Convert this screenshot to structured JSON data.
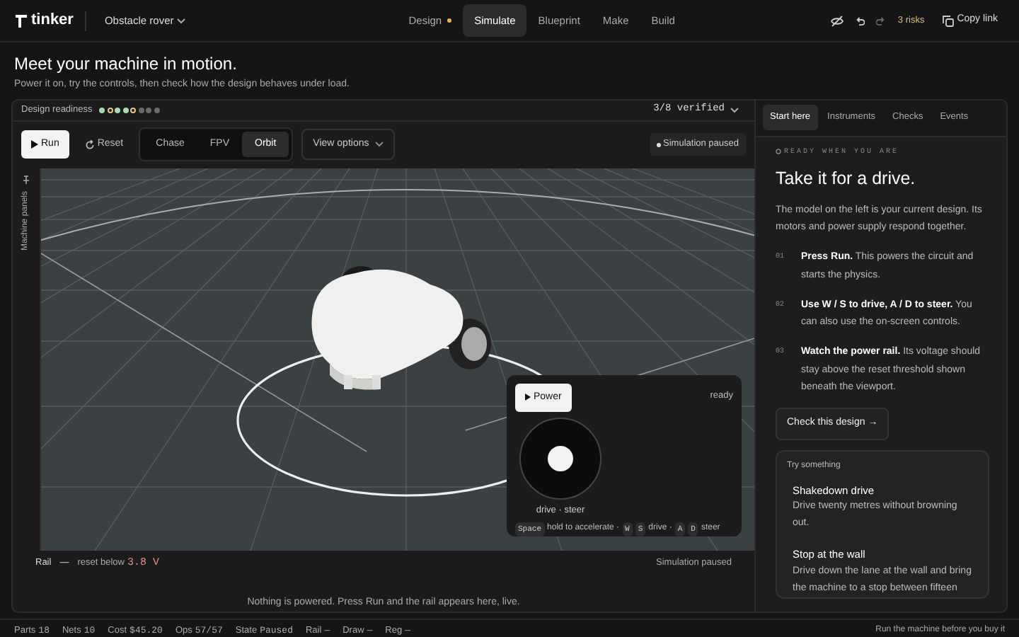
{
  "app": {
    "name": "tinker",
    "project": "Obstacle rover"
  },
  "nav_tabs": [
    {
      "label": "Design",
      "selected": false,
      "dot": true
    },
    {
      "label": "Simulate",
      "selected": true,
      "dot": false
    },
    {
      "label": "Blueprint",
      "selected": false,
      "dot": false
    },
    {
      "label": "Make",
      "selected": false,
      "dot": false
    },
    {
      "label": "Build",
      "selected": false,
      "dot": false
    }
  ],
  "header_actions": {
    "redo_disabled": true,
    "risks": "3 risks",
    "copy_link": "Copy link"
  },
  "page": {
    "title": "Meet your machine in motion.",
    "subtitle": "Power it on, try the controls, then check how the design behaves under load."
  },
  "readiness": {
    "label": "Design readiness",
    "dots": [
      {
        "color": "#a8d8b0",
        "filled": true
      },
      {
        "color": "#e0c98a",
        "filled": false
      },
      {
        "color": "#a8d8b0",
        "filled": true
      },
      {
        "color": "#a8d8b0",
        "filled": true
      },
      {
        "color": "#e0c98a",
        "filled": false
      },
      {
        "color": "#6a6a6a",
        "filled": true
      },
      {
        "color": "#6a6a6a",
        "filled": true
      },
      {
        "color": "#6a6a6a",
        "filled": true
      }
    ],
    "verified": "3/8 verified"
  },
  "toolbar": {
    "run": "Run",
    "reset": "Reset",
    "camera_modes": [
      {
        "label": "Chase",
        "selected": false
      },
      {
        "label": "FPV",
        "selected": false
      },
      {
        "label": "Orbit",
        "selected": true
      }
    ],
    "view_options": "View options",
    "status": "Simulation paused"
  },
  "side_strip": {
    "label": "Machine panels"
  },
  "control_pad": {
    "power": "Power",
    "state": "ready",
    "joystick_label": "drive · steer",
    "hints": [
      {
        "kind": "key",
        "text": "Space"
      },
      {
        "kind": "text",
        "text": "hold to accelerate ·"
      },
      {
        "kind": "key",
        "text": "W"
      },
      {
        "kind": "key",
        "text": "S"
      },
      {
        "kind": "text",
        "text": "drive ·"
      },
      {
        "kind": "key",
        "text": "A"
      },
      {
        "kind": "key",
        "text": "D"
      },
      {
        "kind": "text",
        "text": "steer"
      }
    ]
  },
  "rail": {
    "label": "Rail",
    "value": "—",
    "reset_label": "reset below",
    "threshold": "3.8 V",
    "status": "Simulation paused",
    "message": "Nothing is powered. Press Run and the rail appears here, live."
  },
  "side_tabs": [
    {
      "label": "Start here",
      "selected": true
    },
    {
      "label": "Instruments",
      "selected": false
    },
    {
      "label": "Checks",
      "selected": false
    },
    {
      "label": "Events",
      "selected": false
    }
  ],
  "guide": {
    "eyebrow": "READY WHEN YOU ARE",
    "title": "Take it for a drive.",
    "intro": "The model on the left is your current design. Its motors and power supply respond together.",
    "steps": [
      {
        "number": "01",
        "text": "**Press Run.** This powers the circuit and starts the physics."
      },
      {
        "number": "02",
        "text": "**Use W / S to drive, A / D to steer.** You can also use the on-screen controls."
      },
      {
        "number": "03",
        "text": "**Watch the power rail.** Its voltage should stay above the reset threshold shown beneath the viewport."
      }
    ],
    "check_button": "Check this design →",
    "try_label": "Try something",
    "challenges": [
      {
        "title": "Shakedown drive",
        "text": "Drive twenty metres without browning out."
      },
      {
        "title": "Stop at the wall",
        "text": "Drive down the lane at the wall and bring the machine to a stop between fifteen"
      }
    ]
  },
  "status_bar": {
    "items": [
      {
        "label": "Parts",
        "value": "18"
      },
      {
        "label": "Nets",
        "value": "10"
      },
      {
        "label": "Cost",
        "value": "$45.20"
      },
      {
        "label": "Ops",
        "value": "57/57"
      },
      {
        "label": "State",
        "value": "Paused"
      },
      {
        "label": "Rail",
        "value": "—"
      },
      {
        "label": "Draw",
        "value": "—"
      },
      {
        "label": "Reg",
        "value": "—"
      }
    ],
    "hint": "Run the machine before you buy it"
  }
}
